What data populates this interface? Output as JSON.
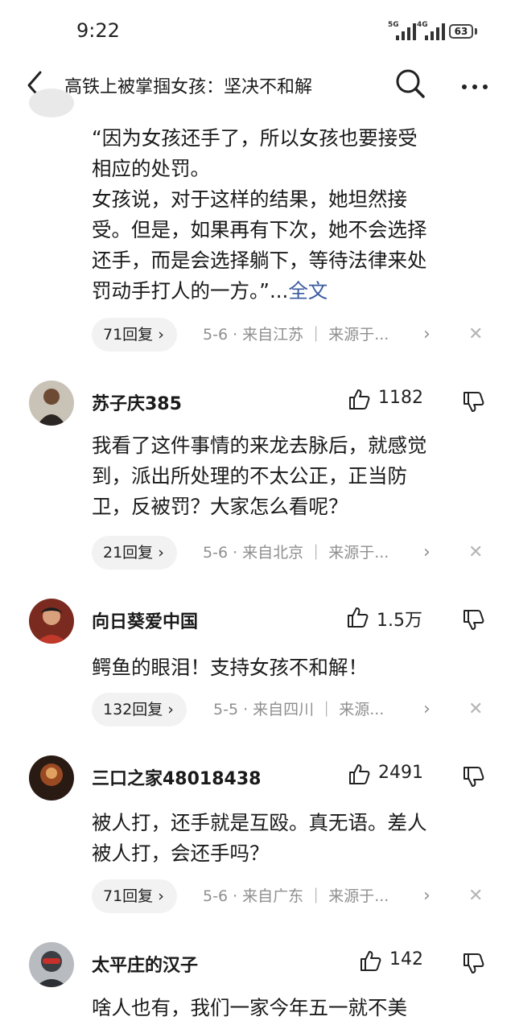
{
  "status_bar": {
    "time": "9:22",
    "sim1_label": "5G",
    "sim2_label": "4G",
    "battery": "63"
  },
  "nav": {
    "title": "高铁上被掌掴女孩：坚决不和解"
  },
  "first_comment": {
    "lines": [
      "“因为女孩还手了，所以女孩也要接受",
      "相应的处罚。",
      "女孩说，对于这样的结果，她坦然接",
      "受。但是，如果再有下次，她不会选择",
      "还手，而是会选择躺下，等待法律来处"
    ],
    "last_line": "罚动手打人的一方。”...",
    "full_text_link": "全文",
    "replies": "71回复",
    "meta": "5-6 · 来自江苏 ｜ 来源于...",
    "arrow": "›",
    "close": "✕"
  },
  "comments": [
    {
      "username": "苏子庆385",
      "likes": "1182",
      "lines": [
        "我看了这件事情的来龙去脉后，就感觉",
        "到，派出所处理的不太公正，正当防",
        "卫，反被罚？大家怎么看呢？"
      ],
      "replies": "21回复",
      "meta": "5-6 · 来自北京 ｜ 来源于...",
      "arrow": "›",
      "close": "✕"
    },
    {
      "username": "向日葵爱中国",
      "likes": "1.5万",
      "lines": [
        "鳄鱼的眼泪！支持女孩不和解！"
      ],
      "replies": "132回复",
      "meta": "5-5 · 来自四川 ｜ 来源...",
      "arrow": "›",
      "close": "✕"
    },
    {
      "username": "三口之家48018438",
      "likes": "2491",
      "lines": [
        "被人打，还手就是互殴。真无语。差人",
        "被人打，会还手吗？"
      ],
      "replies": "71回复",
      "meta": "5-6 · 来自广东 ｜ 来源于...",
      "arrow": "›",
      "close": "✕"
    },
    {
      "username": "太平庄的汉子",
      "likes": "142",
      "lines": [
        "啥人也有，我们一家今年五一就不美"
      ]
    }
  ],
  "icons": {
    "back": "back-icon",
    "search": "search-icon",
    "more": "more-icon",
    "like": "thumbs-up-icon",
    "dislike": "thumbs-down-icon",
    "close": "close-icon"
  },
  "colors": {
    "link": "#3a5aa0",
    "meta_text": "#8f8f8f",
    "pill_bg": "#f2f2f2",
    "text": "#1a1a1a"
  }
}
